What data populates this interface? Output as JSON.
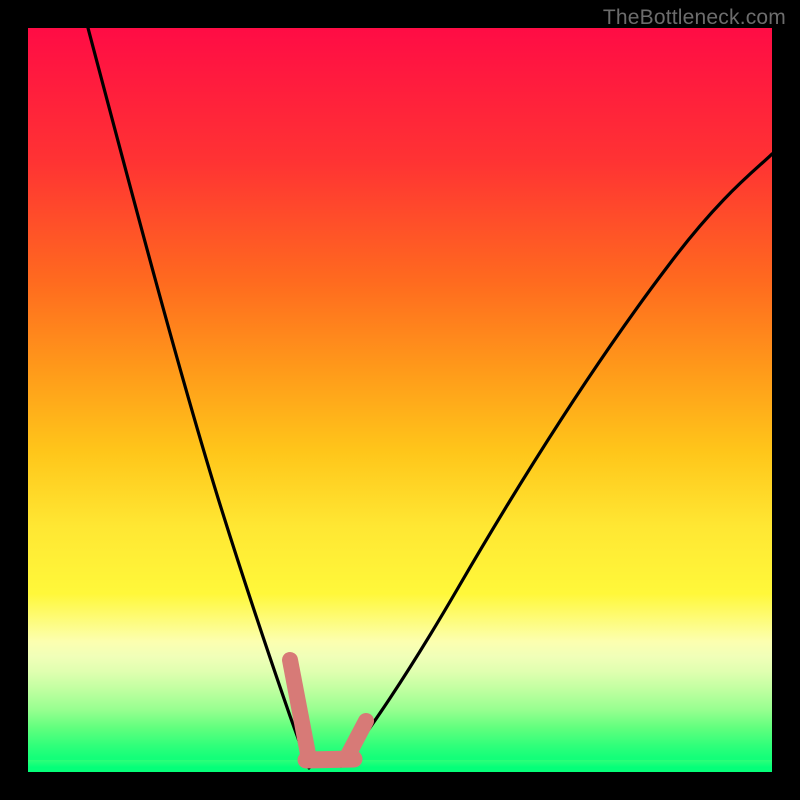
{
  "watermark": "TheBottleneck.com",
  "chart_data": {
    "type": "line",
    "title": "",
    "xlabel": "",
    "ylabel": "",
    "xlim": [
      0,
      100
    ],
    "ylim": [
      0,
      100
    ],
    "grid": false,
    "legend": false,
    "series": [
      {
        "name": "left-curve",
        "x": [
          8.0,
          12.0,
          16.0,
          20.0,
          24.0,
          27.0,
          29.5,
          31.5,
          33.0,
          34.5,
          36.0,
          37.0,
          37.7
        ],
        "values": [
          100.0,
          78.0,
          59.0,
          43.0,
          30.0,
          21.0,
          15.5,
          10.5,
          7.0,
          4.5,
          2.5,
          1.3,
          0.6
        ]
      },
      {
        "name": "right-curve",
        "x": [
          42.0,
          45.0,
          50.0,
          56.0,
          63.0,
          70.0,
          77.0,
          85.0,
          92.0,
          100.0
        ],
        "values": [
          0.8,
          3.0,
          9.0,
          18.0,
          29.5,
          41.0,
          52.0,
          63.5,
          73.5,
          83.0
        ]
      },
      {
        "name": "highlight-left-segment",
        "x": [
          35.5,
          37.5
        ],
        "values": [
          15.0,
          2.0
        ]
      },
      {
        "name": "highlight-bottom-segment",
        "x": [
          37.0,
          43.8
        ],
        "values": [
          1.2,
          1.7
        ]
      },
      {
        "name": "highlight-right-segment",
        "x": [
          42.5,
          45.0
        ],
        "values": [
          1.8,
          7.2
        ]
      }
    ],
    "colors": {
      "curve": "#000000",
      "highlight": "#d77a77",
      "gradient_top": "#ff0c45",
      "gradient_bottom": "#05ff79"
    }
  }
}
